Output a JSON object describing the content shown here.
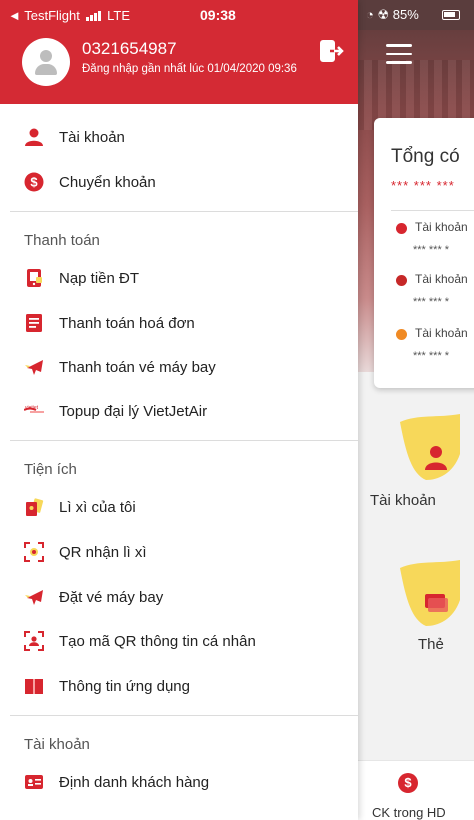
{
  "status_bar": {
    "back_app": "◄ TestFlight",
    "network": "LTE",
    "time": "09:38",
    "battery": "85%"
  },
  "header": {
    "phone": "0321654987",
    "last_login": "Đăng nhập gần nhất lúc 01/04/2020 09:36",
    "logout_icon": "logout-icon"
  },
  "menu": {
    "top_items": [
      {
        "label": "Tài khoản",
        "icon": "person-icon"
      },
      {
        "label": "Chuyển khoản",
        "icon": "transfer-coin-icon"
      }
    ],
    "sections": [
      {
        "title": "Thanh toán",
        "items": [
          {
            "label": "Nạp tiền ĐT",
            "icon": "phone-topup-icon"
          },
          {
            "label": "Thanh toán hoá đơn",
            "icon": "bill-icon"
          },
          {
            "label": "Thanh toán vé máy bay",
            "icon": "plane-icon"
          },
          {
            "label": "Topup đại lý VietJetAir",
            "icon": "vietjet-logo-icon"
          }
        ]
      },
      {
        "title": "Tiện ích",
        "items": [
          {
            "label": "Lì xì của tôi",
            "icon": "red-envelope-icon"
          },
          {
            "label": "QR nhận lì xì",
            "icon": "qr-scan-icon"
          },
          {
            "label": "Đặt vé máy bay",
            "icon": "plane-icon"
          },
          {
            "label": "Tạo mã QR thông tin cá nhân",
            "icon": "qr-person-icon"
          },
          {
            "label": "Thông tin ứng dụng",
            "icon": "book-icon"
          }
        ]
      },
      {
        "title": "Tài khoản",
        "items": [
          {
            "label": "Định danh khách hàng",
            "icon": "id-card-icon"
          }
        ]
      }
    ]
  },
  "background": {
    "balance_title": "Tổng có",
    "balance_masked": "*** *** ***",
    "accounts": [
      {
        "name": "Tài khoản",
        "value": "*** *** *",
        "color": "#d7262f"
      },
      {
        "name": "Tài khoản",
        "value": "*** *** *",
        "color": "#c62828"
      },
      {
        "name": "Tài khoản",
        "value": "*** *** *",
        "color": "#f08a24"
      }
    ],
    "features": [
      {
        "label": "Tài khoản"
      },
      {
        "label": "Thẻ"
      }
    ],
    "bottom_tab": "CK trong HD"
  },
  "colors": {
    "brand_red": "#d42a34",
    "accent_yellow": "#f7d85a"
  }
}
